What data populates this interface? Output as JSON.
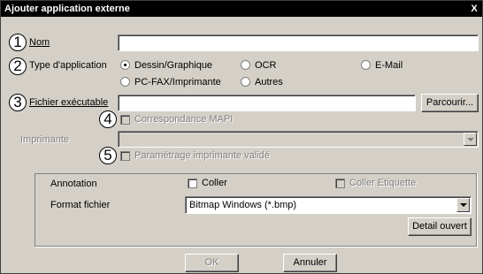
{
  "dialog": {
    "title": "Ajouter application externe",
    "close_glyph": "X",
    "labels": {
      "nom": "Nom",
      "type_application": "Type d'application",
      "fichier_executable": "Fichier exécutable",
      "imprimante": "Imprimante"
    },
    "nom_value": "",
    "fichier_value": "",
    "imprimante_value": "",
    "app_types": [
      {
        "label": "Dessin/Graphique",
        "selected": true
      },
      {
        "label": "OCR",
        "selected": false
      },
      {
        "label": "E-Mail",
        "selected": false
      },
      {
        "label": "PC-FAX/Imprimante",
        "selected": false
      },
      {
        "label": "Autres",
        "selected": false
      }
    ],
    "parcourir_label": "Parcourir...",
    "correspondance_label": "Correspondance MAPI",
    "parametrage_label": "Paramétrage imprimante validé",
    "annotation": {
      "label": "Annotation",
      "coller_label": "Coller",
      "coller_checked": false,
      "coller_etiquette_label": "Coller Etiquette",
      "coller_etiquette_checked": false
    },
    "format_fichier": {
      "label": "Format fichier",
      "value": "Bitmap Windows (*.bmp)"
    },
    "detail_ouvert_label": "Detail ouvert",
    "ok_label": "OK",
    "annuler_label": "Annuler",
    "callouts": [
      "1",
      "2",
      "3",
      "4",
      "5"
    ]
  }
}
